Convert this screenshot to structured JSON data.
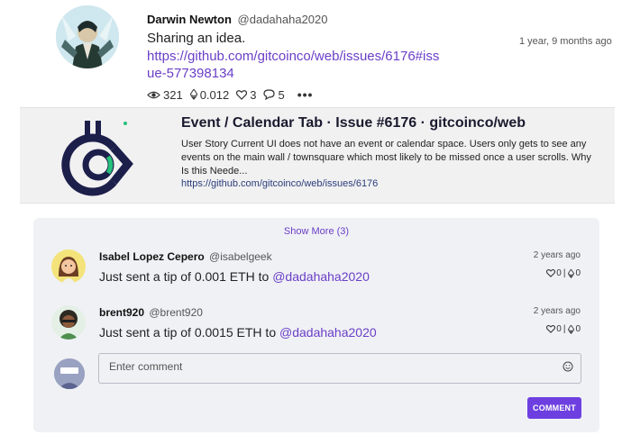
{
  "post": {
    "author_name": "Darwin Newton",
    "author_handle": "@dadahaha2020",
    "text": "Sharing an idea.",
    "link": "https://github.com/gitcoinco/web/issues/6176#issue-577398134",
    "time": "1 year, 9 months ago",
    "stats": {
      "views": "321",
      "eth": "0.012",
      "likes": "3",
      "comments": "5"
    },
    "icons": {
      "views": "eye-icon",
      "eth": "ethereum-icon",
      "likes": "heart-icon",
      "comments": "comment-icon",
      "more": "more-icon"
    }
  },
  "preview": {
    "title": "Event / Calendar Tab · Issue #6176 · gitcoinco/web",
    "description": "User Story Current UI does not have an event or calendar space. Users only gets to see any events on the main wall / townsquare which most likely to be missed once a user scrolls. Why Is this Neede...",
    "url": "https://github.com/gitcoinco/web/issues/6176"
  },
  "comments_section": {
    "show_more": "Show More (3)",
    "items": [
      {
        "name": "Isabel Lopez Cepero",
        "handle": "@isabelgeek",
        "text_prefix": "Just sent a tip of 0.001 ETH to ",
        "mention": "@dadahaha2020",
        "time": "2 years ago",
        "likes": "0",
        "eth": "0"
      },
      {
        "name": "brent920",
        "handle": "@brent920",
        "text_prefix": "Just sent a tip of 0.0015 ETH to ",
        "mention": "@dadahaha2020",
        "time": "2 years ago",
        "likes": "0",
        "eth": "0"
      }
    ],
    "input_placeholder": "Enter comment",
    "submit_label": "COMMENT"
  },
  "colors": {
    "accent": "#6a3fc7",
    "button": "#6d3fe0",
    "panel": "#f0f1f5"
  }
}
